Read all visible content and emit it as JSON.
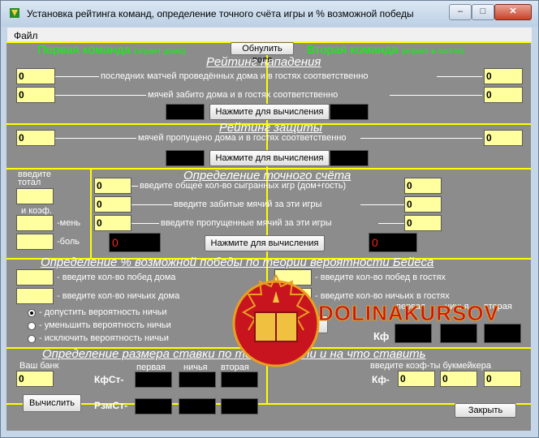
{
  "window": {
    "title": "Установка рейтинга команд, определение точного счёта игры и % возможной победы",
    "btn_min": "–",
    "btn_max": "□",
    "btn_close": "✕"
  },
  "menu": {
    "file": "Файл"
  },
  "header": {
    "team1": "Первая команда",
    "team1_sub": "(играет дома)",
    "reset": "Обнулить поля",
    "team2": "Вторая команда",
    "team2_sub": "(играет в гостях)"
  },
  "attack": {
    "title": "Рейтинг нападения",
    "row1": "последних матчей проведённых дома и в гостях соответственно",
    "row2": "мячей забито дома и в гостях соответственно",
    "in1": "0",
    "in2": "0",
    "in3": "0",
    "in4": "0",
    "calc": "Нажмите для вычисления"
  },
  "defense": {
    "title": "Рейтинг защиты",
    "row1": "мячей пропущено дома и в гостях соответственно",
    "in1": "0",
    "in2": "0",
    "calc": "Нажмите для вычисления"
  },
  "total": {
    "label1": "введите",
    "label2": "тотал",
    "label3": "и коэф.",
    "less": "-мень",
    "more": "-боль"
  },
  "exact": {
    "title": "Определение точного счёта",
    "row1": "введите общее кол-во сыгранных игр (дом+гость)",
    "row2": "введите  забитые мячий за эти игры",
    "row3": "введите  пропущенные мячий за эти игры",
    "in": "0",
    "res1": "0",
    "res2": "0",
    "calc": "Нажмите для вычисления"
  },
  "bayes": {
    "title": "Определение % возможной победы по теории вероятности Бейеса",
    "home_wins": "- введите кол-во  побед дома",
    "home_draws": "- введите кол-во ничьих дома",
    "away_wins": "- введите кол-во  побед в гостях",
    "away_draws": "- введите кол-во ничьих в гостях",
    "opt1": "- допустить вероятность ничьи",
    "opt2": "- уменьшить вероятность ничьи",
    "opt3": "- исключить вероятность ничьи",
    "col1": "первая",
    "col2": "ничья",
    "col3": "вторая",
    "kf": "Кф",
    "calc_partial": "ислить",
    "in": "0"
  },
  "kelly": {
    "title": "Определение размера ставки по теории Келли и на что ставить",
    "bank": "Ваш банк",
    "bank_val": "0",
    "kfst": "КфСт-",
    "rzmst": "РзмСт-",
    "col1": "первая",
    "col2": "ничья",
    "col3": "вторая",
    "coef_hint": "введите коэф-ты букмейкера",
    "kf": "Кф-",
    "calc": "Вычислить",
    "close": "Закрыть",
    "kval": "0"
  },
  "watermark": {
    "text": "DOLINAKURSOV"
  },
  "colors": {
    "panel": "#8c8c8c",
    "input": "#ffffa0",
    "accent": "#ffff00",
    "green": "#00ff00",
    "watermark": "#c8141e"
  }
}
